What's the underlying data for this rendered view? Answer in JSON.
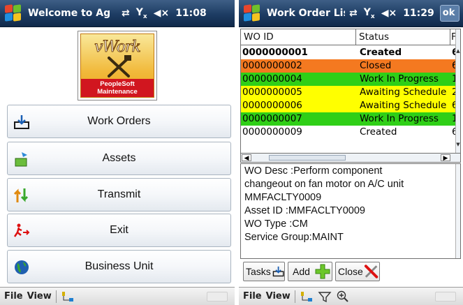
{
  "left": {
    "titlebar": {
      "title": "Welcome to Ag",
      "time": "11:08"
    },
    "logo": {
      "wordmark": "vWork",
      "banner_line1": "PeopleSoft",
      "banner_line2": "Maintenance"
    },
    "menu": [
      {
        "label": "Work Orders",
        "icon": "work-orders-icon"
      },
      {
        "label": "Assets",
        "icon": "assets-icon"
      },
      {
        "label": "Transmit",
        "icon": "transmit-icon"
      },
      {
        "label": "Exit",
        "icon": "exit-icon"
      },
      {
        "label": "Business Unit",
        "icon": "globe-icon"
      }
    ],
    "bottombar": {
      "file": "File",
      "view": "View"
    }
  },
  "right": {
    "titlebar": {
      "title": "Work Order List",
      "time": "11:29",
      "ok": "ok"
    },
    "grid": {
      "columns": [
        "WO ID",
        "Status",
        "F"
      ],
      "rows": [
        {
          "wo": "0000000001",
          "status": "Created",
          "f": "6",
          "color": "#ffffff",
          "bold": true
        },
        {
          "wo": "0000000002",
          "status": "Closed",
          "f": "6",
          "color": "#f47920",
          "bold": false
        },
        {
          "wo": "0000000004",
          "status": "Work In Progress",
          "f": "1",
          "color": "#2fcf17",
          "bold": false
        },
        {
          "wo": "0000000005",
          "status": "Awaiting Schedule",
          "f": "2",
          "color": "#ffff00",
          "bold": false
        },
        {
          "wo": "0000000006",
          "status": "Awaiting Schedule",
          "f": "6",
          "color": "#ffff00",
          "bold": false
        },
        {
          "wo": "0000000007",
          "status": "Work In Progress",
          "f": "1",
          "color": "#2fcf17",
          "bold": false
        },
        {
          "wo": "0000000009",
          "status": "Created",
          "f": "6",
          "color": "#ffffff",
          "bold": false
        }
      ]
    },
    "desc_lines": [
      "WO Desc :Perform component",
      "changeout on fan motor on A/C unit",
      "MMFACLTY0009",
      "Asset ID :MMFACLTY0009",
      "WO Type :CM",
      "Service Group:MAINT"
    ],
    "buttons": {
      "tasks": "Tasks",
      "add": "Add",
      "close": "Close"
    },
    "bottombar": {
      "file": "File",
      "view": "View"
    }
  }
}
